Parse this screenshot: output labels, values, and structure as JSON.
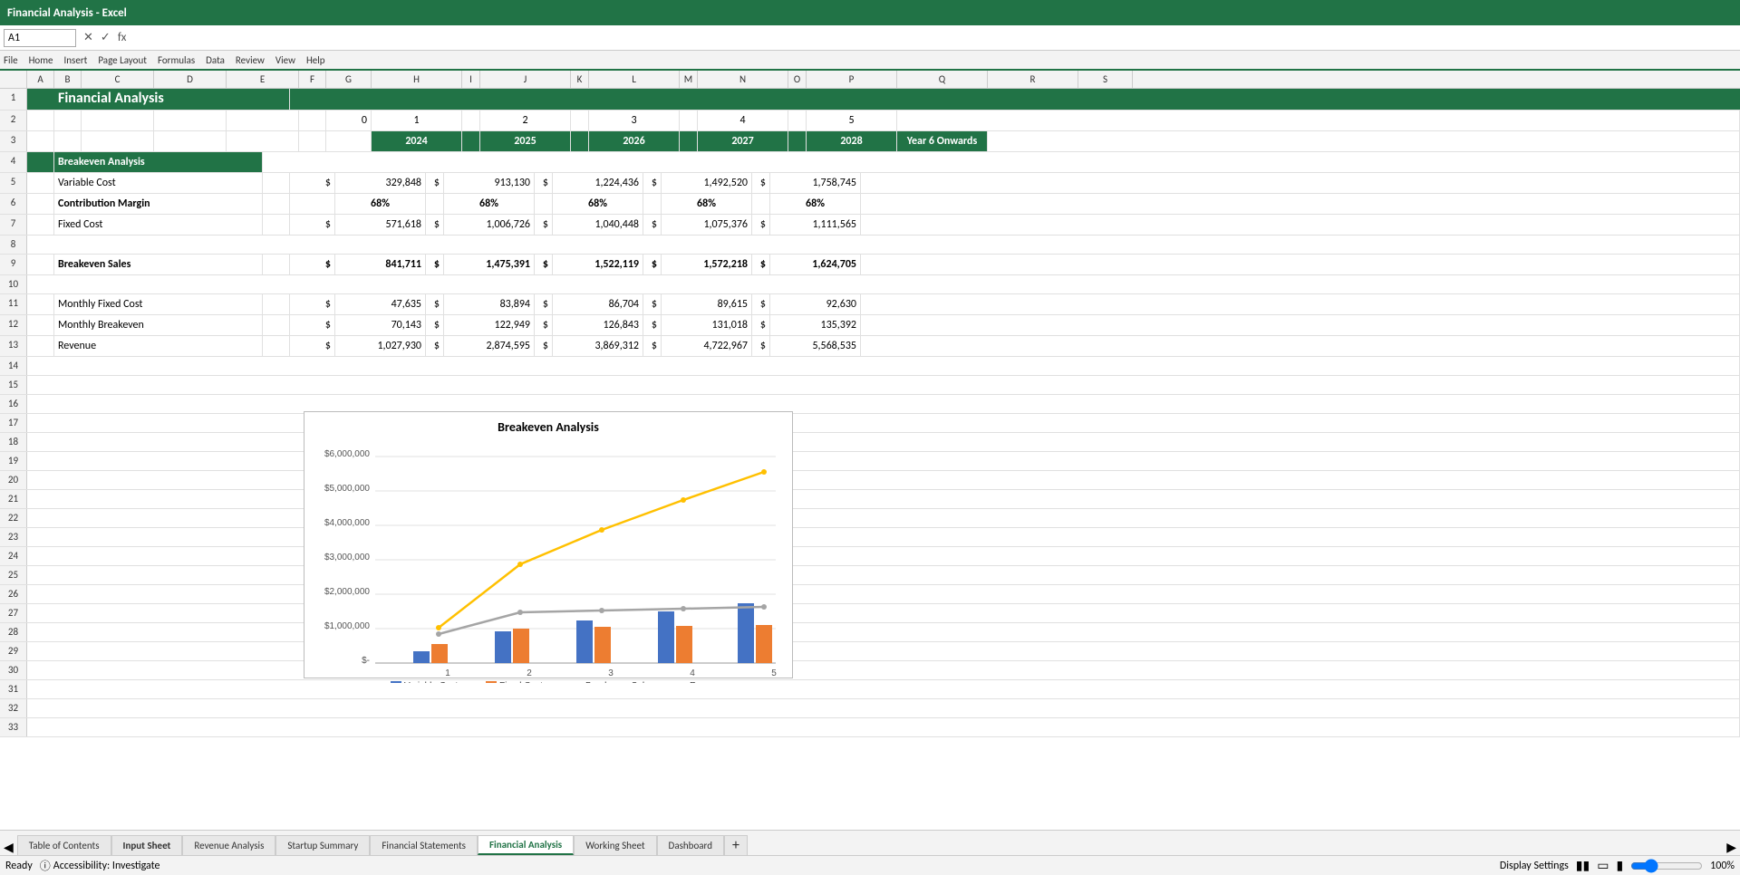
{
  "app": {
    "title": "Financial Analysis - Excel"
  },
  "formulaBar": {
    "cellRef": "A1",
    "formula": ""
  },
  "sheet": {
    "title": "Financial Analysis",
    "sections": {
      "breakeven": "Breakeven Analysis",
      "variableCost": "Variable Cost",
      "contributionMargin": "Contribution Margin",
      "fixedCost": "Fixed Cost",
      "breakevenSales": "Breakeven Sales",
      "monthlyFixedCost": "Monthly Fixed Cost",
      "monthlyBreakeven": "Monthly Breakeven",
      "revenue": "Revenue"
    },
    "years": [
      "2024",
      "2025",
      "2026",
      "2027",
      "2028",
      "Year 6 Onwards"
    ],
    "data": {
      "variableCost": [
        "329,848",
        "913,130",
        "1,224,436",
        "1,492,520",
        "1,758,745"
      ],
      "contributionMargin": [
        "68%",
        "68%",
        "68%",
        "68%",
        "68%"
      ],
      "fixedCost": [
        "571,618",
        "1,006,726",
        "1,040,448",
        "1,075,376",
        "1,111,565"
      ],
      "breakevenSales": [
        "841,711",
        "1,475,391",
        "1,522,119",
        "1,572,218",
        "1,624,705"
      ],
      "monthlyFixedCost": [
        "47,635",
        "83,894",
        "86,704",
        "89,615",
        "92,630"
      ],
      "monthlyBreakeven": [
        "70,143",
        "122,949",
        "126,843",
        "131,018",
        "135,392"
      ],
      "revenue": [
        "1,027,930",
        "2,874,595",
        "3,869,312",
        "4,722,967",
        "5,568,535"
      ]
    },
    "chart": {
      "title": "Breakeven Analysis",
      "legend": [
        "Variable Cost",
        "Fixed Cost",
        "Breakeven Sales",
        "Revenue"
      ],
      "xLabels": [
        "1",
        "2",
        "3",
        "4",
        "5"
      ],
      "yLabels": [
        "$-",
        "$1,000,000",
        "$2,000,000",
        "$3,000,000",
        "$4,000,000",
        "$5,000,000",
        "$6,000,000"
      ]
    }
  },
  "tabs": [
    {
      "label": "Table of Contents",
      "active": false
    },
    {
      "label": "Input Sheet",
      "active": false,
      "bold": true
    },
    {
      "label": "Revenue Analysis",
      "active": false
    },
    {
      "label": "Startup Summary",
      "active": false
    },
    {
      "label": "Financial Statements",
      "active": false
    },
    {
      "label": "Financial Analysis",
      "active": true
    },
    {
      "label": "Working Sheet",
      "active": false
    },
    {
      "label": "Dashboard",
      "active": false
    }
  ],
  "status": {
    "ready": "Ready",
    "accessibility": "Accessibility: Investigate",
    "displaySettings": "Display Settings",
    "zoom": "100%"
  },
  "colors": {
    "green": "#217346",
    "blue": "#4472C4",
    "orange": "#ED7D31",
    "gray": "#A5A5A5",
    "yellow": "#FFC000"
  }
}
